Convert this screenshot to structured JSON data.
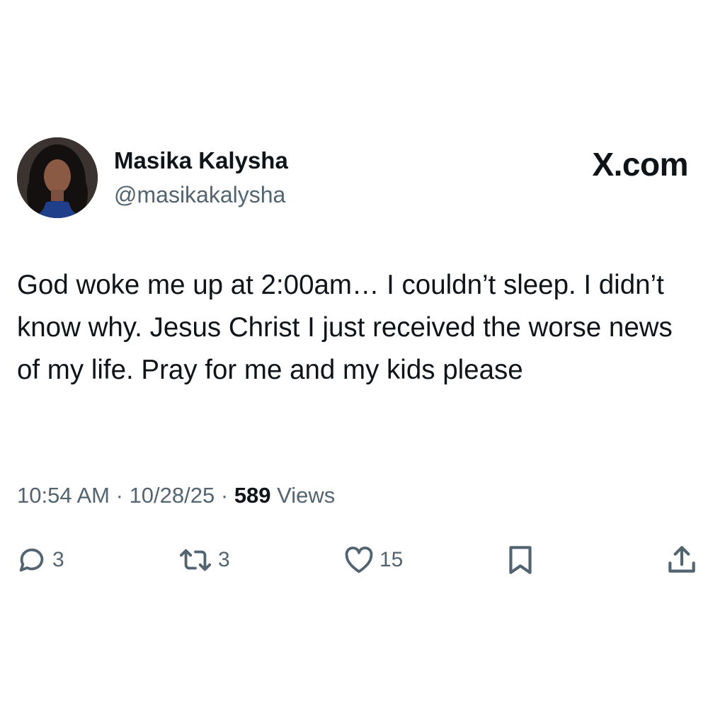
{
  "author": {
    "display_name": "Masika Kalysha",
    "handle": "@masikakalysha"
  },
  "brand": {
    "label": "X.com"
  },
  "post": {
    "text": "God woke me up at 2:00am… I couldn’t sleep. I didn’t know why. Jesus Christ I just received the worse news of my life. Pray for me and my kids please"
  },
  "meta": {
    "time": "10:54 AM",
    "date": "10/28/25",
    "separator": "·",
    "views_count": "589",
    "views_label": "Views"
  },
  "actions": {
    "reply_count": "3",
    "repost_count": "3",
    "like_count": "15"
  },
  "icons": {
    "reply": "speech-bubble-icon",
    "repost": "repost-arrows-icon",
    "like": "heart-icon",
    "bookmark": "bookmark-icon",
    "share": "share-upload-icon"
  },
  "colors": {
    "text_primary": "#0f1419",
    "text_secondary": "#536471",
    "background": "#ffffff"
  }
}
